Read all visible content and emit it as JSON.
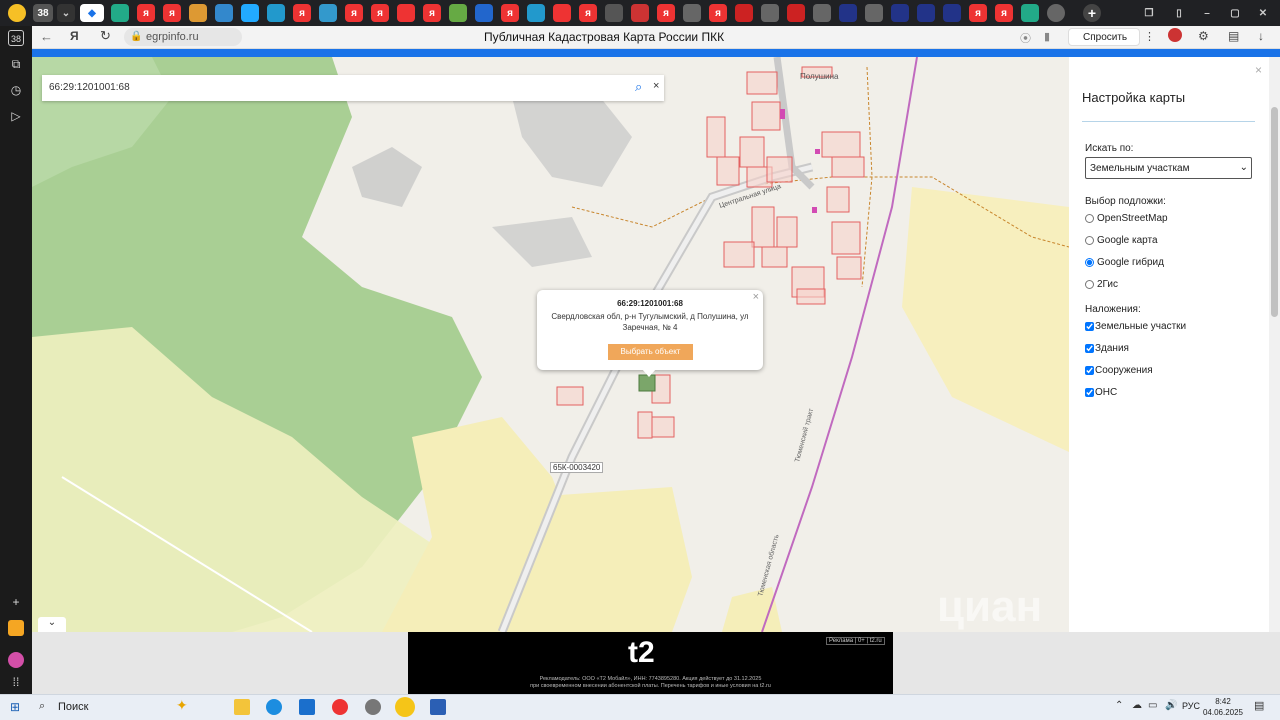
{
  "browser": {
    "tab_counter": "38",
    "address": "egrpinfo.ru",
    "page_title": "Публичная Кадастровая Карта России ПКК",
    "ask_button": "Спросить"
  },
  "map": {
    "search_value": "66:29:1201001:68",
    "search_clear": "×",
    "village_label": "Полушина",
    "street_label": "Центральная улица",
    "road_label": "65К-0003420",
    "rail_label_1": "Тюменский тракт",
    "rail_label_2": "Тюменская область",
    "popup": {
      "cadastral": "66:29:1201001:68",
      "address": "Свердловская обл, р-н Тугулымский, д Полушина, ул Заречная, № 4",
      "select_button": "Выбрать объект",
      "close": "×"
    }
  },
  "panel": {
    "close": "×",
    "title": "Настройка карты",
    "search_by_label": "Искать по:",
    "search_by_value": "Земельным участкам",
    "basemap_label": "Выбор подложки:",
    "basemaps": [
      "OpenStreetMap",
      "Google карта",
      "Google гибрид",
      "2Гис"
    ],
    "basemap_selected": "Google гибрид",
    "overlays_label": "Наложения:",
    "overlays": [
      "Земельные участки",
      "Здания",
      "Сооружения",
      "ОНС"
    ]
  },
  "ad": {
    "logo": "t2",
    "badge": "Реклама | 0+ | t2.ru",
    "line1": "Рекламодатель: ООО «Т2 Мобайл», ИНН: 7743895280. Акция действует до 31.12.2025",
    "line2": "при своевременном внесении абонентской платы. Перечень тарифов и иные условия на t2.ru"
  },
  "watermark": "циан",
  "taskbar": {
    "search_label": "Поиск",
    "lang": "РУС",
    "time": "8:42",
    "date": "04.06.2025"
  }
}
